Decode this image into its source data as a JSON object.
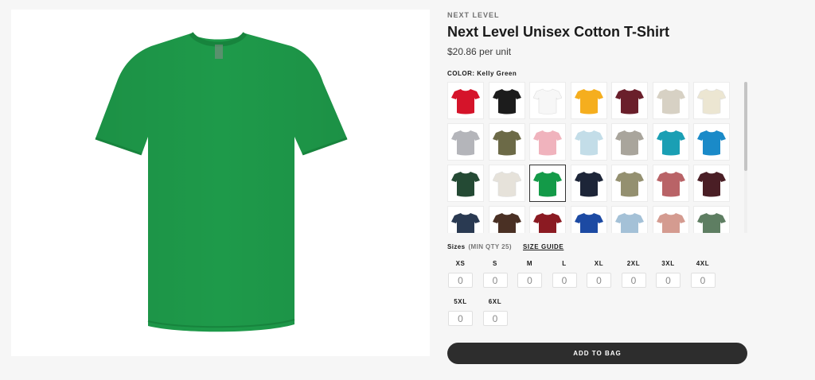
{
  "product": {
    "brand": "NEXT LEVEL",
    "title": "Next Level Unisex Cotton T-Shirt",
    "price": "$20.86 per unit",
    "image_color": "#1e9a4a"
  },
  "color": {
    "label": "COLOR: Kelly Green",
    "selected_index": 16,
    "swatches": [
      "#d5142a",
      "#1c1c1c",
      "#f7f7f7",
      "#f5ae1e",
      "#6a1f2b",
      "#d7d1c4",
      "#ece6d2",
      "#b4b5ba",
      "#6c6a47",
      "#f0b3bd",
      "#c3dde8",
      "#a9a59c",
      "#1a9fb4",
      "#1a8ac8",
      "#244a34",
      "#e6e2da",
      "#139a48",
      "#1d2538",
      "#949070",
      "#b96367",
      "#4a1e25",
      "#2a3a52",
      "#4a3024",
      "#8b1a22",
      "#1c4aa3",
      "#a4c1d7",
      "#d49b90",
      "#5e7e62"
    ]
  },
  "sizes": {
    "label": "Sizes",
    "min_qty": "(MIN QTY 25)",
    "guide_label": "SIZE GUIDE",
    "items": [
      {
        "label": "XS",
        "value": "0"
      },
      {
        "label": "S",
        "value": "0"
      },
      {
        "label": "M",
        "value": "0"
      },
      {
        "label": "L",
        "value": "0"
      },
      {
        "label": "XL",
        "value": "0"
      },
      {
        "label": "2XL",
        "value": "0"
      },
      {
        "label": "3XL",
        "value": "0"
      },
      {
        "label": "4XL",
        "value": "0"
      },
      {
        "label": "5XL",
        "value": "0"
      },
      {
        "label": "6XL",
        "value": "0"
      }
    ]
  },
  "cart": {
    "button_label": "ADD TO BAG"
  }
}
